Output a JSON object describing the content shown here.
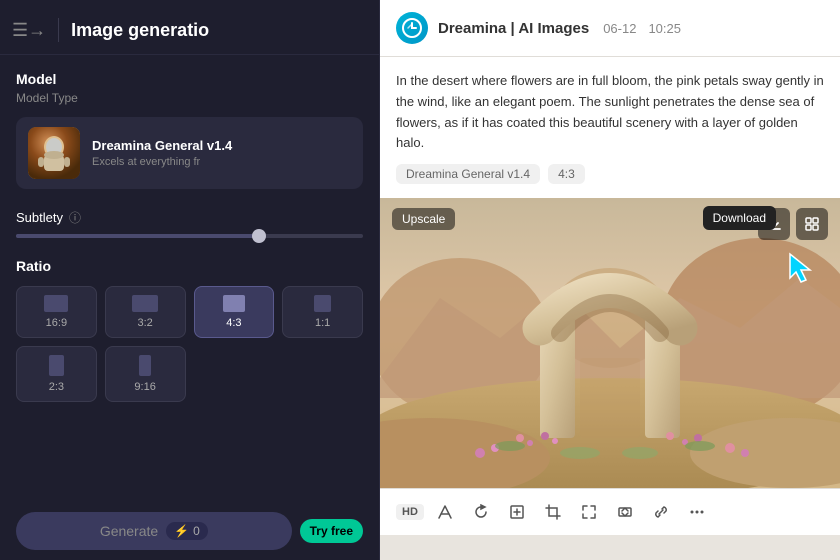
{
  "left_panel": {
    "menu_icon": "☰",
    "arrow_icon": "→",
    "title": "Image generatio",
    "model_section": {
      "label": "Model",
      "sublabel": "Model Type",
      "card": {
        "name": "Dreamina General v1.4",
        "description": "Excels at everything fr"
      }
    },
    "subtlety": {
      "label": "Subtlety",
      "info_icon": "ⓘ"
    },
    "ratio": {
      "label": "Ratio",
      "options": [
        {
          "label": "16:9",
          "active": false,
          "shape": "landscape"
        },
        {
          "label": "3:2",
          "active": false,
          "shape": "landscape2"
        },
        {
          "label": "4:3",
          "active": true,
          "shape": "43"
        },
        {
          "label": "1:1",
          "active": false,
          "shape": "square"
        },
        {
          "label": "2:3",
          "active": false,
          "shape": "portrait"
        },
        {
          "label": "9:16",
          "active": false,
          "shape": "portrait2"
        }
      ]
    },
    "generate_btn": "Generate",
    "credits_icon": "⚡",
    "credits_value": "0",
    "try_free": "Try free"
  },
  "right_panel": {
    "app_icon": "D",
    "app_name": "Dreamina | AI Images",
    "date": "06-12",
    "time": "10:25",
    "description": "In the desert where flowers are in full bloom, the pink petals sway gently in the wind, like an elegant poem. The sunlight penetrates the dense sea of flowers, as if it has coated this beautiful scenery with a layer of golden halo.",
    "tags": [
      "Dreamina General v1.4",
      "4:3"
    ],
    "upscale_label": "Upscale",
    "download_tooltip": "Download",
    "image_alt": "Desert arch scene with flowers",
    "bottom_bar": {
      "hd_badge": "HD",
      "icons": [
        "edit",
        "refresh",
        "upscale",
        "crop",
        "expand",
        "link",
        "more"
      ]
    }
  }
}
